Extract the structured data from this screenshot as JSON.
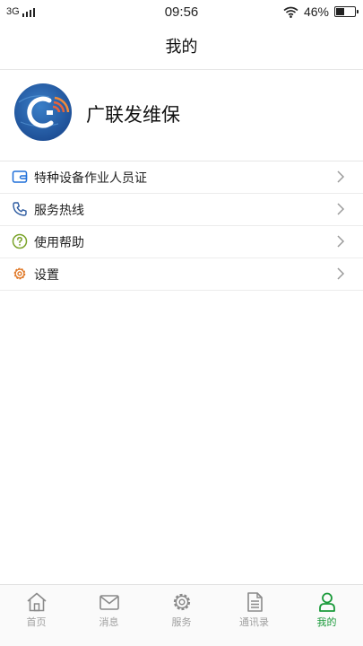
{
  "status_bar": {
    "network": "3G",
    "time": "09:56",
    "battery_percent": "46%",
    "battery_level": 0.46
  },
  "header": {
    "title": "我的"
  },
  "profile": {
    "name": "广联发维保",
    "avatar_icon": "company-logo-icon"
  },
  "menu": {
    "items": [
      {
        "label": "特种设备作业人员证",
        "icon": "wallet-card-icon",
        "icon_color": "#1e6fd9"
      },
      {
        "label": "服务热线",
        "icon": "phone-icon",
        "icon_color": "#2c5aa0"
      },
      {
        "label": "使用帮助",
        "icon": "question-circle-icon",
        "icon_color": "#7aa32a"
      },
      {
        "label": "设置",
        "icon": "gear-icon",
        "icon_color": "#e07a2a"
      }
    ]
  },
  "tabbar": {
    "active_color": "#1a9a3a",
    "inactive_color": "#a0a0a0",
    "items": [
      {
        "label": "首页",
        "icon": "home-icon",
        "active": false
      },
      {
        "label": "消息",
        "icon": "mail-icon",
        "active": false
      },
      {
        "label": "服务",
        "icon": "gear-icon",
        "active": false
      },
      {
        "label": "通讯录",
        "icon": "document-icon",
        "active": false
      },
      {
        "label": "我的",
        "icon": "user-icon",
        "active": true
      }
    ]
  }
}
